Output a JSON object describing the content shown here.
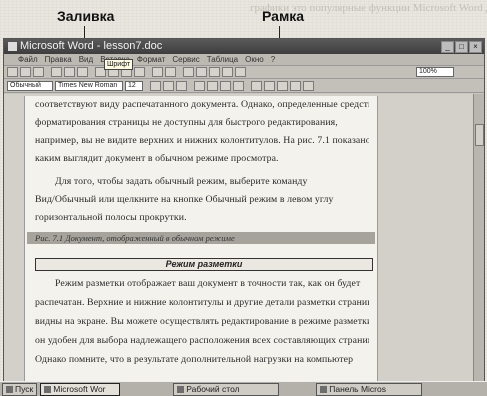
{
  "callouts": {
    "fill_label": "Заливка",
    "frame_label": "Рамка"
  },
  "window": {
    "title": "Microsoft Word - lesson7.doc",
    "menu": [
      "Файл",
      "Правка",
      "Вид",
      "Вставка",
      "Формат",
      "Сервис",
      "Таблица",
      "Окно",
      "?"
    ],
    "zoom": "100%",
    "style_box": "Обычный",
    "font_box": "Times New Roman",
    "size_box": "12",
    "tooltip": "Шрифт"
  },
  "document": {
    "lines": [
      "соответствуют виду распечатанного документа. Однако, определенные средства",
      "форматирования страницы не доступны для быстрого редактирования,",
      "например, вы не видите верхних и нижних колонтитулов. На рис. 7.1 показано,",
      "каким выглядит документ в обычном режиме просмотра.",
      "Для того, чтобы задать обычный режим, выберите команду",
      "Вид/Обычный или щелкните на кнопке Обычный режим в левом углу",
      "горизонтальной полосы прокрутки."
    ],
    "caption": "Рис. 7.1 Документ, отображенный в обычном режиме",
    "heading": "Режим разметки",
    "lines2": [
      "Режим разметки отображает ваш документ в точности так, как он будет",
      "распечатан. Верхние и нижние колонтитулы и другие детали разметки страницы",
      "видны на экране. Вы можете осуществлять редактирование в режиме разметки;",
      "он удобен для выбора надлежащего расположения всех составляющих страницы.",
      "Однако помните, что в результате дополнительной нагрузки на компьютер"
    ]
  },
  "taskbar": {
    "start": "Пуск",
    "items": [
      "Microsoft Wor",
      "Рабочий стол",
      "Панель Micros"
    ]
  }
}
